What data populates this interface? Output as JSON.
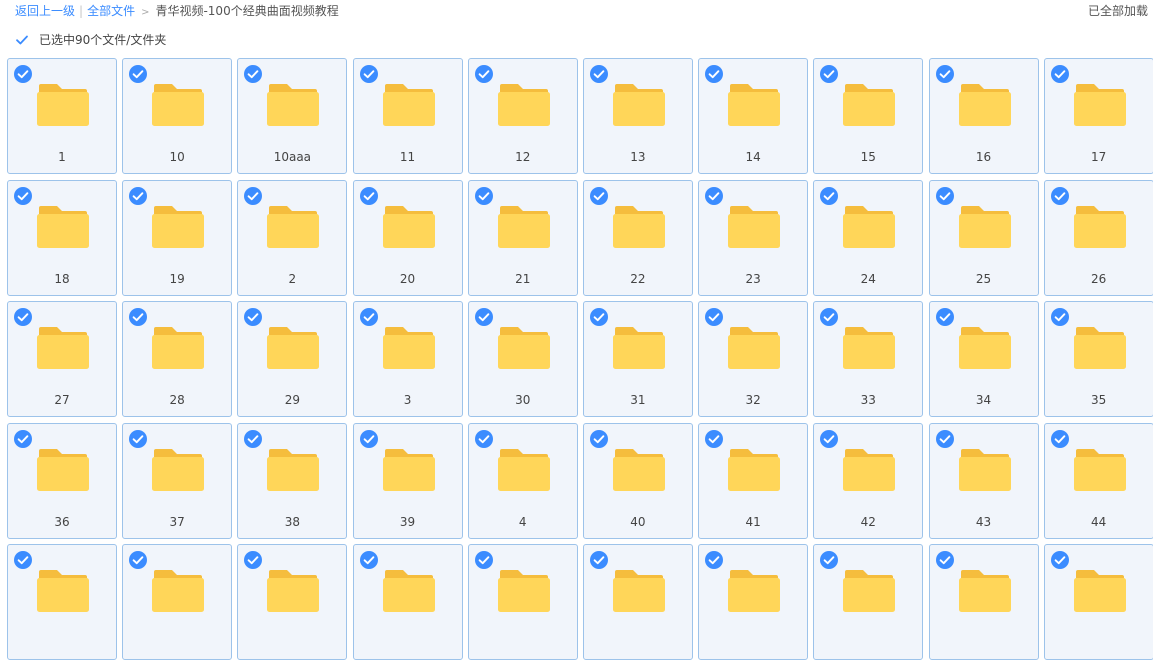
{
  "breadcrumb": {
    "back_label": "返回上一级",
    "all_files_label": "全部文件",
    "separator": ">",
    "current_folder": "青华视频-100个经典曲面视频教程"
  },
  "status": {
    "loaded_label": "已全部加载"
  },
  "selection": {
    "checked": true,
    "count_label": "已选中90个文件/文件夹"
  },
  "colors": {
    "accent": "#3b8cff",
    "tile_border": "#9dc3ea",
    "tile_bg": "#f1f5fb",
    "folder_body": "#ffd659",
    "folder_tab": "#f5bd3d"
  },
  "files": [
    {
      "name": "1",
      "selected": true,
      "icon": "folder-icon"
    },
    {
      "name": "10",
      "selected": true,
      "icon": "folder-icon"
    },
    {
      "name": "10aaa",
      "selected": true,
      "icon": "folder-icon"
    },
    {
      "name": "11",
      "selected": true,
      "icon": "folder-icon"
    },
    {
      "name": "12",
      "selected": true,
      "icon": "folder-icon"
    },
    {
      "name": "13",
      "selected": true,
      "icon": "folder-icon"
    },
    {
      "name": "14",
      "selected": true,
      "icon": "folder-icon"
    },
    {
      "name": "15",
      "selected": true,
      "icon": "folder-icon"
    },
    {
      "name": "16",
      "selected": true,
      "icon": "folder-icon"
    },
    {
      "name": "17",
      "selected": true,
      "icon": "folder-icon"
    },
    {
      "name": "18",
      "selected": true,
      "icon": "folder-icon"
    },
    {
      "name": "19",
      "selected": true,
      "icon": "folder-icon"
    },
    {
      "name": "2",
      "selected": true,
      "icon": "folder-icon"
    },
    {
      "name": "20",
      "selected": true,
      "icon": "folder-icon"
    },
    {
      "name": "21",
      "selected": true,
      "icon": "folder-icon"
    },
    {
      "name": "22",
      "selected": true,
      "icon": "folder-icon"
    },
    {
      "name": "23",
      "selected": true,
      "icon": "folder-icon"
    },
    {
      "name": "24",
      "selected": true,
      "icon": "folder-icon"
    },
    {
      "name": "25",
      "selected": true,
      "icon": "folder-icon"
    },
    {
      "name": "26",
      "selected": true,
      "icon": "folder-icon"
    },
    {
      "name": "27",
      "selected": true,
      "icon": "folder-icon"
    },
    {
      "name": "28",
      "selected": true,
      "icon": "folder-icon"
    },
    {
      "name": "29",
      "selected": true,
      "icon": "folder-icon"
    },
    {
      "name": "3",
      "selected": true,
      "icon": "folder-icon"
    },
    {
      "name": "30",
      "selected": true,
      "icon": "folder-icon"
    },
    {
      "name": "31",
      "selected": true,
      "icon": "folder-icon"
    },
    {
      "name": "32",
      "selected": true,
      "icon": "folder-icon"
    },
    {
      "name": "33",
      "selected": true,
      "icon": "folder-icon"
    },
    {
      "name": "34",
      "selected": true,
      "icon": "folder-icon"
    },
    {
      "name": "35",
      "selected": true,
      "icon": "folder-icon"
    },
    {
      "name": "36",
      "selected": true,
      "icon": "folder-icon"
    },
    {
      "name": "37",
      "selected": true,
      "icon": "folder-icon"
    },
    {
      "name": "38",
      "selected": true,
      "icon": "folder-icon"
    },
    {
      "name": "39",
      "selected": true,
      "icon": "folder-icon"
    },
    {
      "name": "4",
      "selected": true,
      "icon": "folder-icon"
    },
    {
      "name": "40",
      "selected": true,
      "icon": "folder-icon"
    },
    {
      "name": "41",
      "selected": true,
      "icon": "folder-icon"
    },
    {
      "name": "42",
      "selected": true,
      "icon": "folder-icon"
    },
    {
      "name": "43",
      "selected": true,
      "icon": "folder-icon"
    },
    {
      "name": "44",
      "selected": true,
      "icon": "folder-icon"
    },
    {
      "name": "",
      "selected": true,
      "icon": "folder-icon"
    },
    {
      "name": "",
      "selected": true,
      "icon": "folder-icon"
    },
    {
      "name": "",
      "selected": true,
      "icon": "folder-icon"
    },
    {
      "name": "",
      "selected": true,
      "icon": "folder-icon"
    },
    {
      "name": "",
      "selected": true,
      "icon": "folder-icon"
    },
    {
      "name": "",
      "selected": true,
      "icon": "folder-icon"
    },
    {
      "name": "",
      "selected": true,
      "icon": "folder-icon"
    },
    {
      "name": "",
      "selected": true,
      "icon": "folder-icon"
    },
    {
      "name": "",
      "selected": true,
      "icon": "folder-icon"
    },
    {
      "name": "",
      "selected": true,
      "icon": "folder-icon"
    }
  ]
}
